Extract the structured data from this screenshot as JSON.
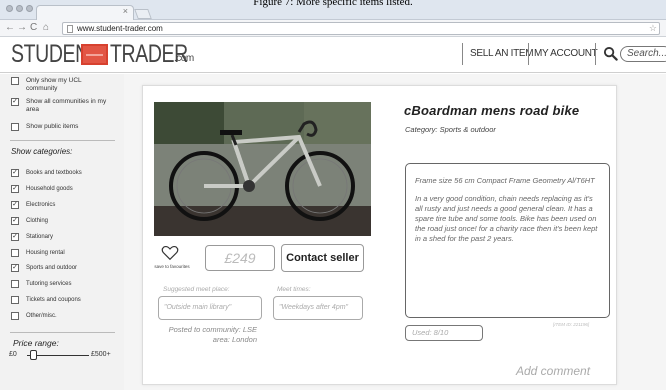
{
  "caption": "Figure 7: More specific items listed.",
  "browser": {
    "url": "www.student-trader.com",
    "back_icon": "arrow-left-icon",
    "forward_icon": "arrow-right-icon",
    "reload_label": "C",
    "home_icon": "home-icon",
    "tab_close": "×",
    "bookmark_star": "☆"
  },
  "header": {
    "logo_part1": "STUDENT",
    "logo_part2": "TRADER",
    "logo_suffix": ".com",
    "logo_color": "#e25645",
    "sell_label": "SELL AN ITEM",
    "account_label": "MY ACCOUNT",
    "search_placeholder": "Search..."
  },
  "sidebar": {
    "scope": [
      {
        "label": "Only show my UCL community",
        "checked": false
      },
      {
        "label": "Show all communities in my area",
        "checked": true
      },
      {
        "label": "Show public items",
        "checked": false
      }
    ],
    "categories_heading": "Show categories:",
    "categories": [
      {
        "label": "Books and textbooks",
        "checked": true
      },
      {
        "label": "Household goods",
        "checked": true
      },
      {
        "label": "Electronics",
        "checked": true
      },
      {
        "label": "Clothing",
        "checked": true
      },
      {
        "label": "Stationary",
        "checked": true
      },
      {
        "label": "Housing rental",
        "checked": false
      },
      {
        "label": "Sports and outdoor",
        "checked": true
      },
      {
        "label": "Tutoring services",
        "checked": false
      },
      {
        "label": "Tickets and coupons",
        "checked": false
      },
      {
        "label": "Other/misc.",
        "checked": false
      }
    ],
    "price_range_label": "Price range:",
    "price_min": "£0",
    "price_max": "£500+",
    "price_slider_fraction": 0.1
  },
  "item": {
    "title": "cBoardman mens road bike",
    "category": "Category: Sports & outdoor",
    "price": "£249",
    "favourite_label": "save to favourites",
    "contact_label": "Contact seller",
    "meet_place_label": "Suggested meet place:",
    "meet_place_value": "\"Outside main library\"",
    "meet_time_label": "Meet times:",
    "meet_time_value": "\"Weekdays after 4pm\"",
    "posted_line1": "Posted to community: LSE",
    "posted_line2": "area: London",
    "description_p1": "Frame size 56 cm Compact Frame Geometry Al/T6HT",
    "description_p2": "In a very good condition, chain needs replacing as it's all rusty and just needs a good general clean. It has a spare tire tube and some tools. Bike has been used on the road just once! for a charity race then it's been kept in a shed for the past 2 years.",
    "item_id": "[ITEM ID: 221196]",
    "used": "Used: 8/10",
    "add_comment": "Add comment"
  }
}
